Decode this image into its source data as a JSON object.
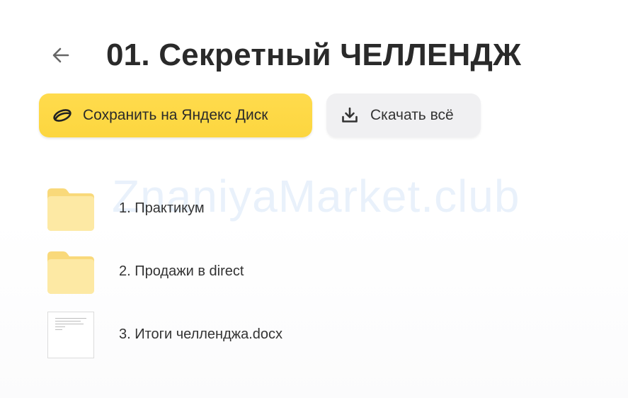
{
  "header": {
    "title": "01. Секретный ЧЕЛЛЕНДЖ",
    "back_icon": "arrow-left-icon"
  },
  "actions": {
    "save_label": "Сохранить на Яндекс Диск",
    "save_icon": "yandex-disk-icon",
    "download_label": "Скачать всё",
    "download_icon": "download-icon"
  },
  "files": [
    {
      "name": "1. Практикум",
      "type": "folder",
      "icon": "folder-icon"
    },
    {
      "name": "2. Продажи в direct",
      "type": "folder",
      "icon": "folder-icon"
    },
    {
      "name": "3. Итоги челленджа.docx",
      "type": "document",
      "icon": "document-thumbnail"
    }
  ],
  "watermark": "ZnaniyaMarket.club",
  "colors": {
    "save_button": "#fdd835",
    "download_button": "#f0f0f2",
    "folder": "#fde9a4",
    "title": "#2a2a2a"
  }
}
